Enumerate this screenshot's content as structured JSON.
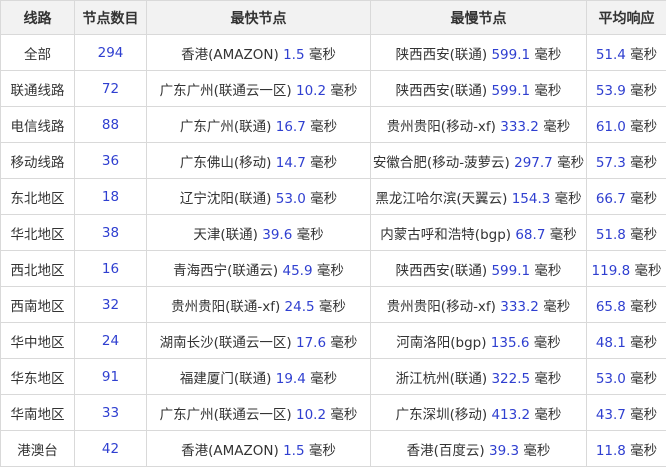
{
  "headers": [
    "线路",
    "节点数目",
    "最快节点",
    "最慢节点",
    "平均响应"
  ],
  "unit": "毫秒",
  "rows": [
    {
      "line": "全部",
      "count": "294",
      "fast_node": "香港(AMAZON)",
      "fast_ms": "1.5",
      "slow_node": "陕西西安(联通)",
      "slow_ms": "599.1",
      "avg_ms": "51.4"
    },
    {
      "line": "联通线路",
      "count": "72",
      "fast_node": "广东广州(联通云一区)",
      "fast_ms": "10.2",
      "slow_node": "陕西西安(联通)",
      "slow_ms": "599.1",
      "avg_ms": "53.9"
    },
    {
      "line": "电信线路",
      "count": "88",
      "fast_node": "广东广州(联通)",
      "fast_ms": "16.7",
      "slow_node": "贵州贵阳(移动-xf)",
      "slow_ms": "333.2",
      "avg_ms": "61.0"
    },
    {
      "line": "移动线路",
      "count": "36",
      "fast_node": "广东佛山(移动)",
      "fast_ms": "14.7",
      "slow_node": "安徽合肥(移动-菠萝云)",
      "slow_ms": "297.7",
      "avg_ms": "57.3"
    },
    {
      "line": "东北地区",
      "count": "18",
      "fast_node": "辽宁沈阳(联通)",
      "fast_ms": "53.0",
      "slow_node": "黑龙江哈尔滨(天翼云)",
      "slow_ms": "154.3",
      "avg_ms": "66.7"
    },
    {
      "line": "华北地区",
      "count": "38",
      "fast_node": "天津(联通)",
      "fast_ms": "39.6",
      "slow_node": "内蒙古呼和浩特(bgp)",
      "slow_ms": "68.7",
      "avg_ms": "51.8"
    },
    {
      "line": "西北地区",
      "count": "16",
      "fast_node": "青海西宁(联通云)",
      "fast_ms": "45.9",
      "slow_node": "陕西西安(联通)",
      "slow_ms": "599.1",
      "avg_ms": "119.8"
    },
    {
      "line": "西南地区",
      "count": "32",
      "fast_node": "贵州贵阳(联通-xf)",
      "fast_ms": "24.5",
      "slow_node": "贵州贵阳(移动-xf)",
      "slow_ms": "333.2",
      "avg_ms": "65.8"
    },
    {
      "line": "华中地区",
      "count": "24",
      "fast_node": "湖南长沙(联通云一区)",
      "fast_ms": "17.6",
      "slow_node": "河南洛阳(bgp)",
      "slow_ms": "135.6",
      "avg_ms": "48.1"
    },
    {
      "line": "华东地区",
      "count": "91",
      "fast_node": "福建厦门(联通)",
      "fast_ms": "19.4",
      "slow_node": "浙江杭州(联通)",
      "slow_ms": "322.5",
      "avg_ms": "53.0"
    },
    {
      "line": "华南地区",
      "count": "33",
      "fast_node": "广东广州(联通云一区)",
      "fast_ms": "10.2",
      "slow_node": "广东深圳(移动)",
      "slow_ms": "413.2",
      "avg_ms": "43.7"
    },
    {
      "line": "港澳台",
      "count": "42",
      "fast_node": "香港(AMAZON)",
      "fast_ms": "1.5",
      "slow_node": "香港(百度云)",
      "slow_ms": "39.3",
      "avg_ms": "11.8"
    }
  ]
}
